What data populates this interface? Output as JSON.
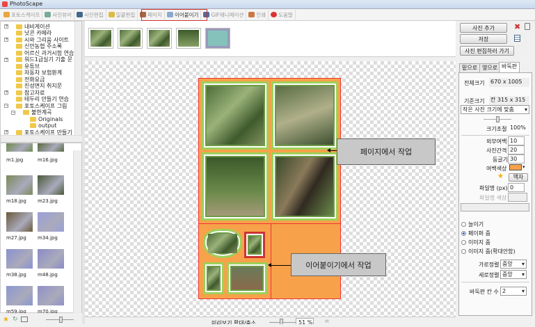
{
  "app": {
    "title": "PhotoScape"
  },
  "toolbar": {
    "tabs": [
      "포토스케이프",
      "사진뷰어",
      "사진편집",
      "일괄편집",
      "페이지",
      "이어붙이기",
      "GIF애니메이션",
      "인쇄",
      "도움말"
    ]
  },
  "tree": {
    "items": [
      "내비게이션",
      "낫콘 카메라",
      "시와 그리움 사이트",
      "신안농협 주소록",
      "어르신 과거시험 연습",
      "워드1급실기 기출 문",
      "유튜브",
      "자동차 보험환계",
      "전화요금",
      "진성면지 취지문",
      "참고자료",
      "테두리 만들기 연습",
      "포토스케이프 그림",
      "불한계곡",
      "Originals",
      "output",
      "포토스케이프 만들기"
    ]
  },
  "thumbnails": [
    "m1.jpg",
    "m16.jpg",
    "m18.jpg",
    "m23.jpg",
    "m27.jpg",
    "m34.jpg",
    "m38.jpg",
    "m48.jpg",
    "m59.jpg",
    "m70.jpg"
  ],
  "right": {
    "add_photo": "사진 추가",
    "save": "저장",
    "go_edit": "사진 편집하러 가기",
    "tabs": [
      "밑으로",
      "옆으로",
      "바둑판"
    ],
    "total_size_label": "전체크기",
    "total_size": "670 x 1005",
    "base_size_label": "기준크기",
    "base_size": "칸 315 x 315",
    "fit_option": "작은 사진 크기에 맞춤",
    "scale_label": "크기조절",
    "scale": "100%",
    "outer_margin_label": "외부여백",
    "outer_margin": "10",
    "spacing_label": "사진간격",
    "spacing": "20",
    "round_label": "둥글기",
    "round": "30",
    "margin_color_label": "여백색상",
    "margin_color": "#f7a24a",
    "frame_button": "액자",
    "frame_px_label": "파일명 (px)",
    "frame_px": "0",
    "frame_color_label": "파일명 색상",
    "radios": [
      "늘이기",
      "페이퍼 줌",
      "이미지 줌",
      "이미지 줌(확대안함)"
    ],
    "selected_radio": 1,
    "h_align_label": "가로정렬",
    "h_align": "중앙",
    "v_align_label": "세로정렬",
    "v_align": "중앙",
    "columns_label": "바둑판 칸 수",
    "columns": "2"
  },
  "callouts": {
    "page": "페이지에서 작업",
    "stitch": "이어붙이기에서 작업"
  },
  "status": {
    "zoom_label": "미리보기 확대/축소",
    "zoom": "51 %"
  }
}
